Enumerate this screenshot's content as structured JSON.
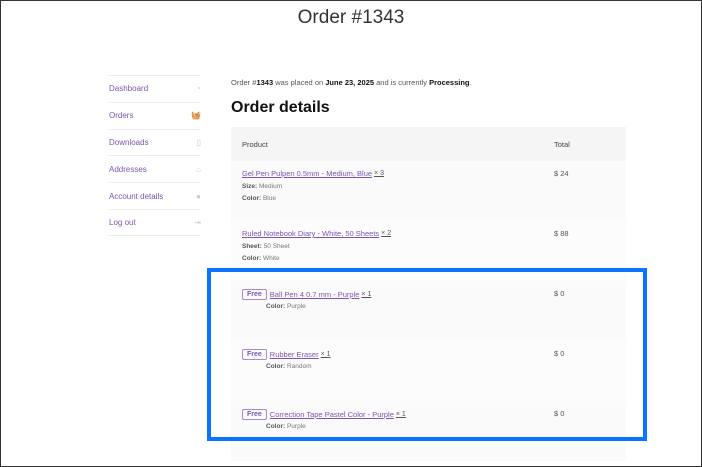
{
  "page": {
    "title": "Order #1343"
  },
  "nav": [
    {
      "label": "Dashboard",
      "icon": "dashboard-icon"
    },
    {
      "label": "Orders",
      "icon": "basket-icon"
    },
    {
      "label": "Downloads",
      "icon": "file-icon"
    },
    {
      "label": "Addresses",
      "icon": "home-icon"
    },
    {
      "label": "Account details",
      "icon": "user-icon"
    },
    {
      "label": "Log out",
      "icon": "logout-icon"
    }
  ],
  "intro": {
    "a": "Order #",
    "num": "1343",
    "b": " was placed on ",
    "date": "June 23, 2025",
    "c": " and is currently ",
    "status": "Processing",
    "d": "."
  },
  "heading": "Order details",
  "table": {
    "headers": {
      "product": "Product",
      "total": "Total"
    },
    "rows": [
      {
        "name": "Gel Pen Pulpen 0.5mm - Medium, Blue",
        "qty": "× 3",
        "meta": [
          {
            "k": "Size:",
            "v": "Medium"
          },
          {
            "k": "Color:",
            "v": "Blue"
          }
        ],
        "total": "$ 24"
      },
      {
        "name": "Ruled Notebook Diary - White, 50 Sheets",
        "qty": "× 2",
        "meta": [
          {
            "k": "Sheet:",
            "v": "50 Sheet"
          },
          {
            "k": "Color:",
            "v": "White"
          }
        ],
        "total": "$ 88"
      },
      {
        "badge": "Free",
        "name": "Ball Pen 4 0.7 mm - Purple",
        "qty": "× 1",
        "meta": [
          {
            "k": "Color:",
            "v": "Purple"
          }
        ],
        "total": "$ 0"
      },
      {
        "badge": "Free",
        "name": "Rubber Eraser",
        "qty": "× 1",
        "meta": [
          {
            "k": "Color:",
            "v": "Random"
          }
        ],
        "total": "$ 0"
      },
      {
        "badge": "Free",
        "name": "Correction Tape Pastel Color - Purple",
        "qty": "× 1",
        "meta": [
          {
            "k": "Color:",
            "v": "Purple"
          }
        ],
        "total": "$ 0"
      }
    ]
  }
}
